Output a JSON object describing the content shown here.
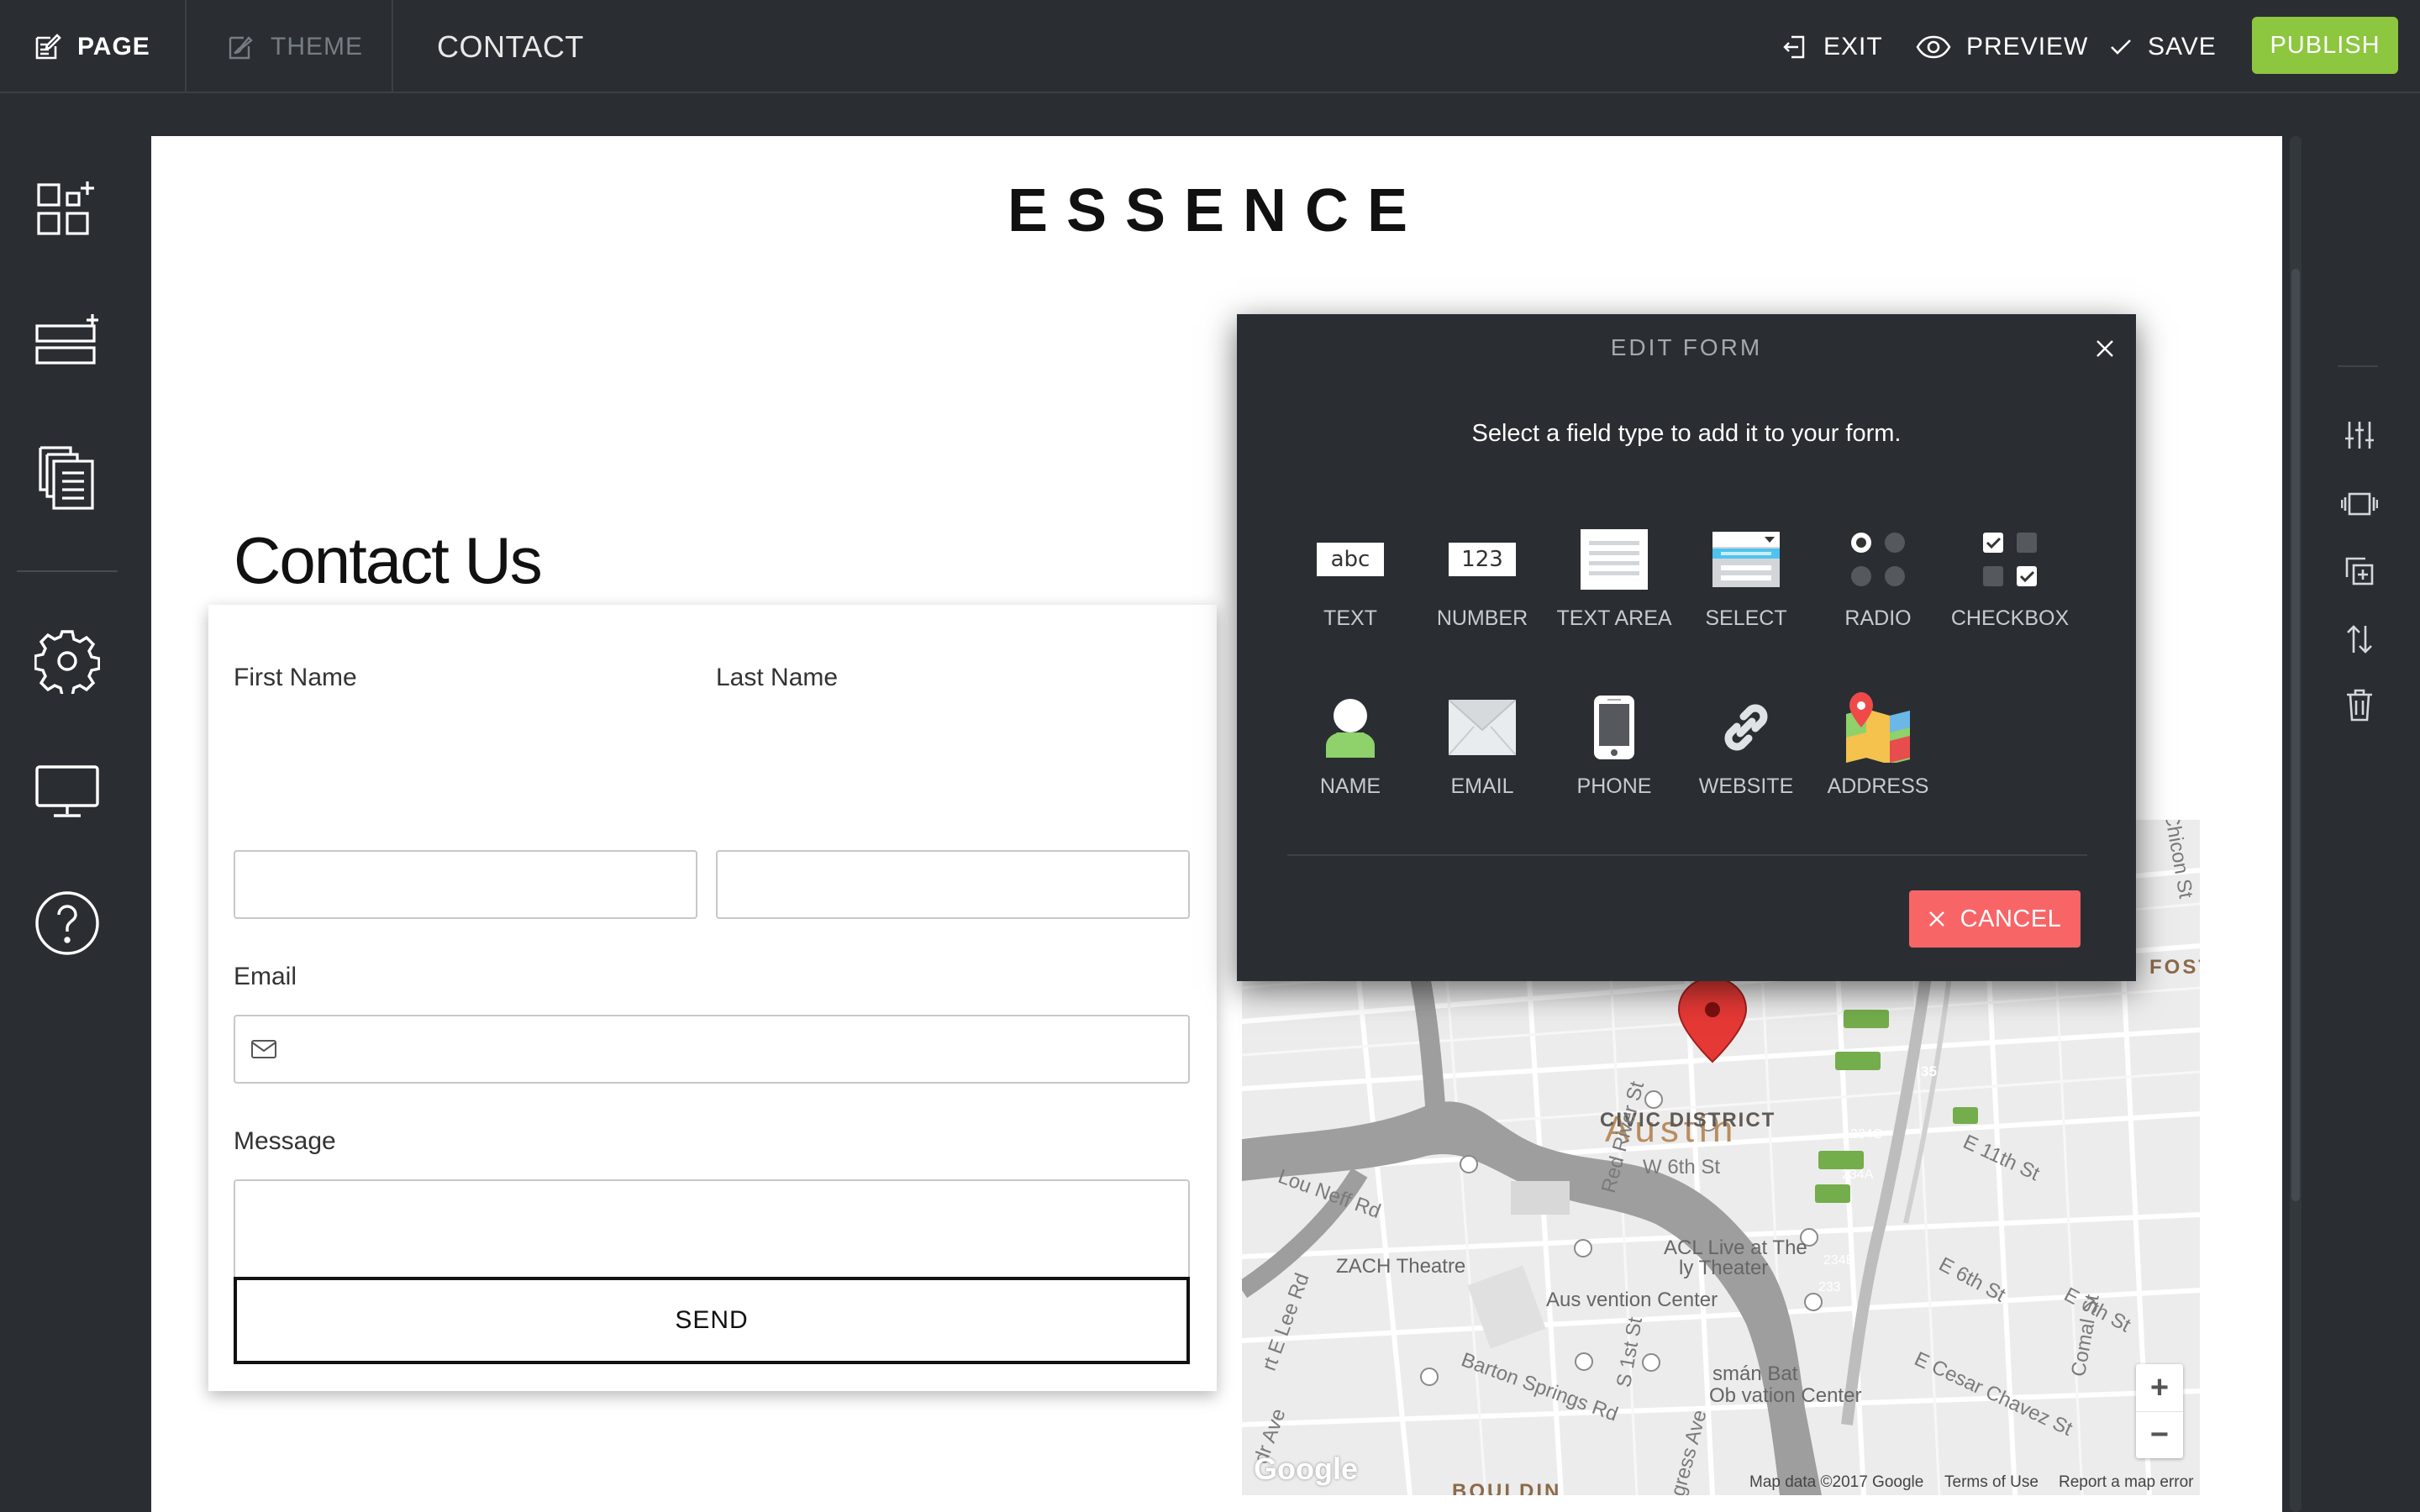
{
  "topbar": {
    "page_label": "PAGE",
    "theme_label": "THEME",
    "current_page": "CONTACT",
    "exit_label": "EXIT",
    "preview_label": "PREVIEW",
    "save_label": "SAVE",
    "publish_label": "PUBLISH",
    "publish_color": "#8dc63f"
  },
  "sidebar": {
    "items": [
      {
        "name": "add-element",
        "icon": "grid-plus-icon"
      },
      {
        "name": "add-section",
        "icon": "rows-plus-icon"
      },
      {
        "name": "pages",
        "icon": "pages-icon"
      },
      {
        "name": "settings",
        "icon": "gear-icon"
      },
      {
        "name": "desktop-preview",
        "icon": "monitor-icon"
      },
      {
        "name": "help",
        "icon": "help-icon"
      }
    ]
  },
  "right_tools": [
    {
      "name": "adjust",
      "icon": "sliders-icon"
    },
    {
      "name": "layout",
      "icon": "carousel-icon"
    },
    {
      "name": "duplicate",
      "icon": "duplicate-icon"
    },
    {
      "name": "reorder",
      "icon": "sort-icon"
    },
    {
      "name": "delete",
      "icon": "trash-icon"
    }
  ],
  "site": {
    "logo": "ESSENCE",
    "heading": "Contact Us"
  },
  "form": {
    "first_name_label": "First Name",
    "last_name_label": "Last Name",
    "email_label": "Email",
    "message_label": "Message",
    "send_label": "SEND"
  },
  "map": {
    "city": "Austin",
    "district": "CIVIC DISTRICT",
    "places": {
      "acl": "ACL Live at The",
      "theater": "ly Theater",
      "zach": "ZACH Theatre",
      "convention": "Aus      vention Center",
      "bat": "smán Bat",
      "observation": "Ob      vation Center",
      "bouldin": "BOULDIN",
      "foster": "FOSTE"
    },
    "streets": {
      "w6th": "W 6th St",
      "e11th": "E 11th St",
      "e6th": "E 6th St",
      "e7th": "E 7th St",
      "cesar": "E Cesar Chavez St",
      "barton": "Barton Springs Rd",
      "s1st": "S 1st St",
      "congress": "gress Ave",
      "red_river": "Red River St",
      "comal": "Comal St",
      "lou_neff": "Lou Neff Rd",
      "e_lee": "rt E Lee Rd",
      "chicon": "Chicon St",
      "dr": "dr Ave"
    },
    "shields": {
      "i35": "35",
      "x234c": "234C",
      "x234a": "234A",
      "x234b": "234B",
      "x233": "233"
    },
    "google": "Google",
    "footer_data": "Map data ©2017 Google",
    "footer_terms": "Terms of Use",
    "footer_report": "Report a map error",
    "zoom_in": "+",
    "zoom_out": "−"
  },
  "modal": {
    "title": "EDIT FORM",
    "subtitle": "Select a field type to add it to your form.",
    "field_types": [
      {
        "label": "TEXT",
        "icon": "text-field-icon",
        "glyph": "abc"
      },
      {
        "label": "NUMBER",
        "icon": "number-field-icon",
        "glyph": "123"
      },
      {
        "label": "TEXT AREA",
        "icon": "textarea-field-icon"
      },
      {
        "label": "SELECT",
        "icon": "select-field-icon"
      },
      {
        "label": "RADIO",
        "icon": "radio-field-icon"
      },
      {
        "label": "CHECKBOX",
        "icon": "checkbox-field-icon"
      },
      {
        "label": "NAME",
        "icon": "person-icon"
      },
      {
        "label": "EMAIL",
        "icon": "envelope-icon"
      },
      {
        "label": "PHONE",
        "icon": "phone-icon"
      },
      {
        "label": "WEBSITE",
        "icon": "link-icon"
      },
      {
        "label": "ADDRESS",
        "icon": "map-pin-icon"
      }
    ],
    "cancel_label": "CANCEL",
    "cancel_color": "#f86567"
  }
}
